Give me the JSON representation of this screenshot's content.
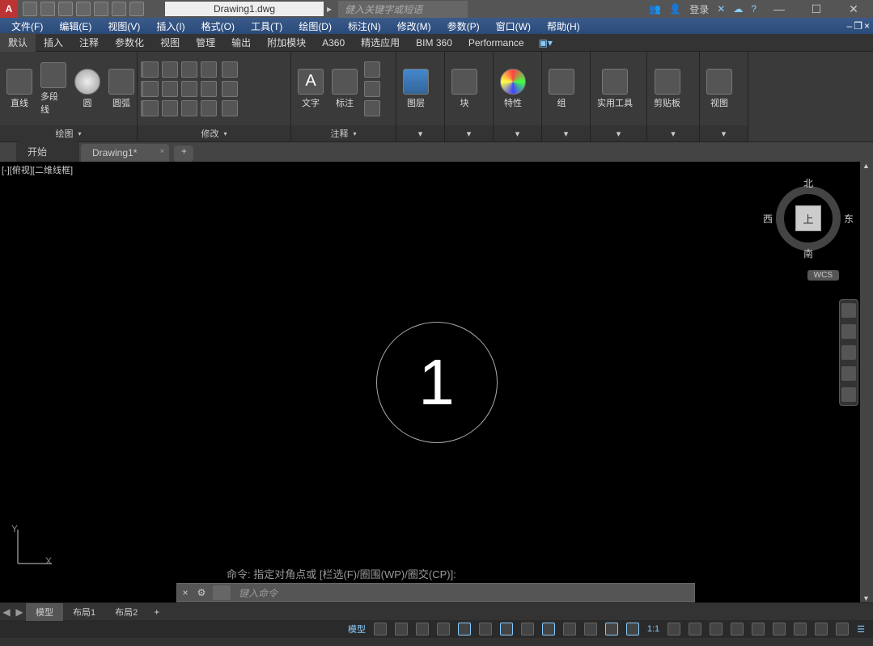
{
  "title": "Drawing1.dwg",
  "search_placeholder": "健入关键字或短语",
  "login_label": "登录",
  "menus": [
    "文件(F)",
    "编辑(E)",
    "视图(V)",
    "插入(I)",
    "格式(O)",
    "工具(T)",
    "绘图(D)",
    "标注(N)",
    "修改(M)",
    "参数(P)",
    "窗口(W)",
    "帮助(H)"
  ],
  "ribbon_tabs": [
    "默认",
    "插入",
    "注释",
    "参数化",
    "视图",
    "管理",
    "输出",
    "附加模块",
    "A360",
    "精选应用",
    "BIM 360",
    "Performance"
  ],
  "panels": {
    "draw": {
      "title": "绘图",
      "btns": [
        "直线",
        "多段线",
        "圆",
        "圆弧"
      ]
    },
    "modify": {
      "title": "修改"
    },
    "annot": {
      "title": "注释",
      "btns": [
        "文字",
        "标注"
      ]
    },
    "layer": {
      "title": "图层"
    },
    "block": {
      "title": "块"
    },
    "props": {
      "title": "特性"
    },
    "group": {
      "title": "组"
    },
    "util": {
      "title": "实用工具"
    },
    "clip": {
      "title": "剪贴板"
    },
    "view": {
      "title": "视图"
    }
  },
  "file_tabs": {
    "start": "开始",
    "drawing": "Drawing1*"
  },
  "viewport_label": "[-][俯视][二维线框]",
  "compass": {
    "n": "北",
    "s": "南",
    "e": "东",
    "w": "西",
    "top": "上",
    "wcs": "WCS"
  },
  "center_number": "1",
  "ucs": {
    "x": "X",
    "y": "Y"
  },
  "cmd_history": "命令: 指定对角点或 [栏选(F)/圈围(WP)/圈交(CP)]:",
  "cmd_placeholder": "键入命令",
  "layout_tabs": {
    "model": "模型",
    "l1": "布局1",
    "l2": "布局2"
  },
  "status": {
    "model": "模型",
    "scale": "1:1"
  }
}
